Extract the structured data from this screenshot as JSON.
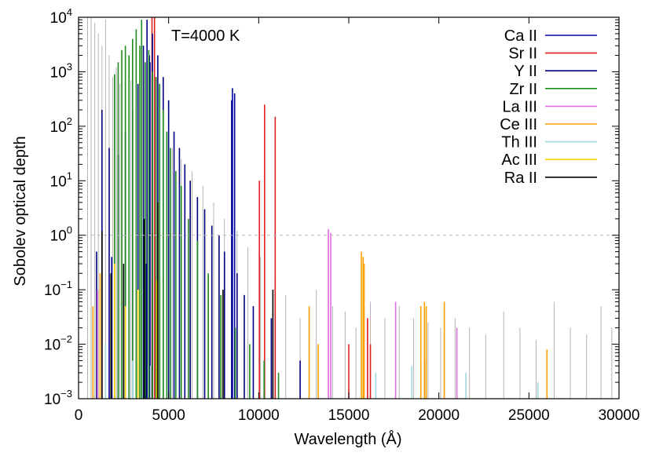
{
  "chart_data": {
    "type": "line",
    "subtype": "stick-spectrum",
    "title": "",
    "annotation": "T=4000 K",
    "xlabel": "Wavelength (Å)",
    "ylabel": "Sobolev optical depth",
    "xlim": [
      0,
      30000
    ],
    "ylim": [
      0.001,
      10000
    ],
    "yscale": "log",
    "xticks": [
      0,
      5000,
      10000,
      15000,
      20000,
      25000,
      30000
    ],
    "xtick_labels": [
      "0",
      "5000",
      "10000",
      "15000",
      "20000",
      "25000",
      "30000"
    ],
    "yticks": [
      0.001,
      0.01,
      0.1,
      1,
      10,
      100,
      1000,
      10000
    ],
    "ytick_labels": [
      {
        "base": "10",
        "exp": "−3"
      },
      {
        "base": "10",
        "exp": "−2"
      },
      {
        "base": "10",
        "exp": "−1"
      },
      {
        "base": "10",
        "exp": "0"
      },
      {
        "base": "10",
        "exp": "1"
      },
      {
        "base": "10",
        "exp": "2"
      },
      {
        "base": "10",
        "exp": "3"
      },
      {
        "base": "10",
        "exp": "4"
      }
    ],
    "reference_line": {
      "y": 1,
      "style": "dashed",
      "color": "#bbbbbb"
    },
    "grid": false,
    "legend_position": "top-right",
    "background_series": {
      "color": "#b3b3b3",
      "description_in_legend": false,
      "lines": [
        {
          "x": 500,
          "y": 10000
        },
        {
          "x": 700,
          "y": 10000
        },
        {
          "x": 900,
          "y": 8000
        },
        {
          "x": 1100,
          "y": 5000
        },
        {
          "x": 1300,
          "y": 3000
        },
        {
          "x": 1500,
          "y": 9000
        },
        {
          "x": 1700,
          "y": 2000
        },
        {
          "x": 1900,
          "y": 800
        },
        {
          "x": 2100,
          "y": 1200
        },
        {
          "x": 2300,
          "y": 600
        },
        {
          "x": 2600,
          "y": 400
        },
        {
          "x": 2900,
          "y": 700
        },
        {
          "x": 3200,
          "y": 900
        },
        {
          "x": 3500,
          "y": 300
        },
        {
          "x": 3900,
          "y": 200
        },
        {
          "x": 4300,
          "y": 120
        },
        {
          "x": 4700,
          "y": 60
        },
        {
          "x": 5200,
          "y": 40
        },
        {
          "x": 5700,
          "y": 25
        },
        {
          "x": 6300,
          "y": 15
        },
        {
          "x": 6900,
          "y": 8
        },
        {
          "x": 7500,
          "y": 4
        },
        {
          "x": 8100,
          "y": 2
        },
        {
          "x": 8800,
          "y": 1.2
        },
        {
          "x": 9400,
          "y": 0.6
        },
        {
          "x": 10100,
          "y": 0.4
        },
        {
          "x": 10900,
          "y": 0.15
        },
        {
          "x": 11500,
          "y": 0.08
        },
        {
          "x": 12300,
          "y": 0.03
        },
        {
          "x": 13200,
          "y": 0.1
        },
        {
          "x": 14100,
          "y": 0.05
        },
        {
          "x": 14800,
          "y": 0.04
        },
        {
          "x": 15400,
          "y": 0.02
        },
        {
          "x": 16200,
          "y": 0.06
        },
        {
          "x": 17000,
          "y": 0.03
        },
        {
          "x": 17800,
          "y": 0.05
        },
        {
          "x": 18600,
          "y": 0.03
        },
        {
          "x": 19400,
          "y": 0.025
        },
        {
          "x": 20100,
          "y": 0.02
        },
        {
          "x": 20900,
          "y": 0.03
        },
        {
          "x": 21700,
          "y": 0.02
        },
        {
          "x": 22600,
          "y": 0.015
        },
        {
          "x": 23600,
          "y": 0.04
        },
        {
          "x": 24500,
          "y": 0.02
        },
        {
          "x": 25400,
          "y": 0.012
        },
        {
          "x": 26400,
          "y": 0.06
        },
        {
          "x": 27300,
          "y": 0.02
        },
        {
          "x": 28200,
          "y": 0.015
        },
        {
          "x": 29000,
          "y": 0.05
        },
        {
          "x": 29600,
          "y": 0.02
        }
      ]
    },
    "series": [
      {
        "name": "Ca II",
        "color": "#0000a0",
        "lines": [
          {
            "x": 3706,
            "y": 0.2
          },
          {
            "x": 3737,
            "y": 0.3
          },
          {
            "x": 3934,
            "y": 2000
          },
          {
            "x": 3968,
            "y": 1500
          },
          {
            "x": 8498,
            "y": 300
          },
          {
            "x": 8542,
            "y": 500
          },
          {
            "x": 8662,
            "y": 400
          },
          {
            "x": 1840,
            "y": 0.4
          }
        ]
      },
      {
        "name": "Sr II",
        "color": "#e02020",
        "lines": [
          {
            "x": 4078,
            "y": 10000
          },
          {
            "x": 4216,
            "y": 10000
          },
          {
            "x": 4306,
            "y": 800
          },
          {
            "x": 10037,
            "y": 10
          },
          {
            "x": 10327,
            "y": 250
          },
          {
            "x": 10915,
            "y": 150
          },
          {
            "x": 15000,
            "y": 0.01
          },
          {
            "x": 16040,
            "y": 0.03
          },
          {
            "x": 16200,
            "y": 0.01
          },
          {
            "x": 19200,
            "y": 0.005
          }
        ]
      },
      {
        "name": "Y II",
        "color": "#000080",
        "lines": [
          {
            "x": 1000,
            "y": 0.5
          },
          {
            "x": 1300,
            "y": 200
          },
          {
            "x": 1700,
            "y": 40
          },
          {
            "x": 2200,
            "y": 30
          },
          {
            "x": 2600,
            "y": 80
          },
          {
            "x": 3000,
            "y": 200
          },
          {
            "x": 3300,
            "y": 600
          },
          {
            "x": 3600,
            "y": 3000
          },
          {
            "x": 3800,
            "y": 9000
          },
          {
            "x": 4100,
            "y": 5000
          },
          {
            "x": 4400,
            "y": 2000
          },
          {
            "x": 4700,
            "y": 800
          },
          {
            "x": 5000,
            "y": 300
          },
          {
            "x": 5300,
            "y": 80
          },
          {
            "x": 5600,
            "y": 40
          },
          {
            "x": 5900,
            "y": 20
          },
          {
            "x": 6200,
            "y": 10
          },
          {
            "x": 6600,
            "y": 5
          },
          {
            "x": 7000,
            "y": 3
          },
          {
            "x": 7400,
            "y": 1.5
          },
          {
            "x": 7800,
            "y": 1
          },
          {
            "x": 8100,
            "y": 0.5
          },
          {
            "x": 8800,
            "y": 0.2
          },
          {
            "x": 9200,
            "y": 0.08
          },
          {
            "x": 9700,
            "y": 0.05
          },
          {
            "x": 10700,
            "y": 0.03
          },
          {
            "x": 12300,
            "y": 0.005
          }
        ]
      },
      {
        "name": "Zr II",
        "color": "#1f8a1f",
        "lines": [
          {
            "x": 2000,
            "y": 900
          },
          {
            "x": 2200,
            "y": 1500
          },
          {
            "x": 2400,
            "y": 2500
          },
          {
            "x": 2600,
            "y": 3000
          },
          {
            "x": 2800,
            "y": 2000
          },
          {
            "x": 3000,
            "y": 4000
          },
          {
            "x": 3200,
            "y": 6000
          },
          {
            "x": 3400,
            "y": 3000
          },
          {
            "x": 3500,
            "y": 9000
          },
          {
            "x": 3700,
            "y": 1500
          },
          {
            "x": 3900,
            "y": 2500
          },
          {
            "x": 4100,
            "y": 1000
          },
          {
            "x": 4300,
            "y": 800
          },
          {
            "x": 4500,
            "y": 600
          },
          {
            "x": 4700,
            "y": 200
          },
          {
            "x": 4900,
            "y": 80
          },
          {
            "x": 5100,
            "y": 40
          },
          {
            "x": 5400,
            "y": 15
          },
          {
            "x": 5700,
            "y": 8
          },
          {
            "x": 6100,
            "y": 2
          },
          {
            "x": 6600,
            "y": 0.8
          },
          {
            "x": 7200,
            "y": 0.2
          },
          {
            "x": 7900,
            "y": 0.08
          },
          {
            "x": 8700,
            "y": 0.02
          },
          {
            "x": 9500,
            "y": 0.01
          },
          {
            "x": 10300,
            "y": 0.005
          },
          {
            "x": 11100,
            "y": 0.003
          }
        ]
      },
      {
        "name": "La III",
        "color": "#e070e0",
        "lines": [
          {
            "x": 1050,
            "y": 0.1
          },
          {
            "x": 13870,
            "y": 1.3
          },
          {
            "x": 14000,
            "y": 1.1
          },
          {
            "x": 17600,
            "y": 0.06
          },
          {
            "x": 21000,
            "y": 0.02
          }
        ]
      },
      {
        "name": "Ce III",
        "color": "#ffa000",
        "lines": [
          {
            "x": 800,
            "y": 0.05
          },
          {
            "x": 1200,
            "y": 0.2
          },
          {
            "x": 15700,
            "y": 0.5
          },
          {
            "x": 15800,
            "y": 0.4
          },
          {
            "x": 15850,
            "y": 0.3
          },
          {
            "x": 19000,
            "y": 0.05
          },
          {
            "x": 19200,
            "y": 0.06
          },
          {
            "x": 19300,
            "y": 0.05
          },
          {
            "x": 20300,
            "y": 0.06
          },
          {
            "x": 26000,
            "y": 0.008
          },
          {
            "x": 12800,
            "y": 0.05
          },
          {
            "x": 13300,
            "y": 0.01
          }
        ]
      },
      {
        "name": "Th III",
        "color": "#a0d8e0",
        "lines": [
          {
            "x": 1500,
            "y": 0.01
          },
          {
            "x": 2000,
            "y": 0.02
          },
          {
            "x": 3000,
            "y": 0.005
          },
          {
            "x": 4000,
            "y": 0.004
          },
          {
            "x": 16500,
            "y": 0.003
          },
          {
            "x": 18500,
            "y": 0.004
          },
          {
            "x": 21500,
            "y": 0.003
          },
          {
            "x": 25500,
            "y": 0.002
          }
        ]
      },
      {
        "name": "Ac III",
        "color": "#ffd000",
        "lines": [
          {
            "x": 2000,
            "y": 0.3
          },
          {
            "x": 2600,
            "y": 0.05
          },
          {
            "x": 3300,
            "y": 0.1
          },
          {
            "x": 4350,
            "y": 0.15
          }
        ]
      },
      {
        "name": "Ra II",
        "color": "#000000",
        "lines": [
          {
            "x": 1300,
            "y": 1.2
          },
          {
            "x": 1800,
            "y": 0.2
          },
          {
            "x": 2500,
            "y": 0.3
          },
          {
            "x": 3650,
            "y": 2
          },
          {
            "x": 4400,
            "y": 4
          },
          {
            "x": 8019,
            "y": 0.1
          },
          {
            "x": 10788,
            "y": 0.1
          }
        ]
      }
    ]
  }
}
